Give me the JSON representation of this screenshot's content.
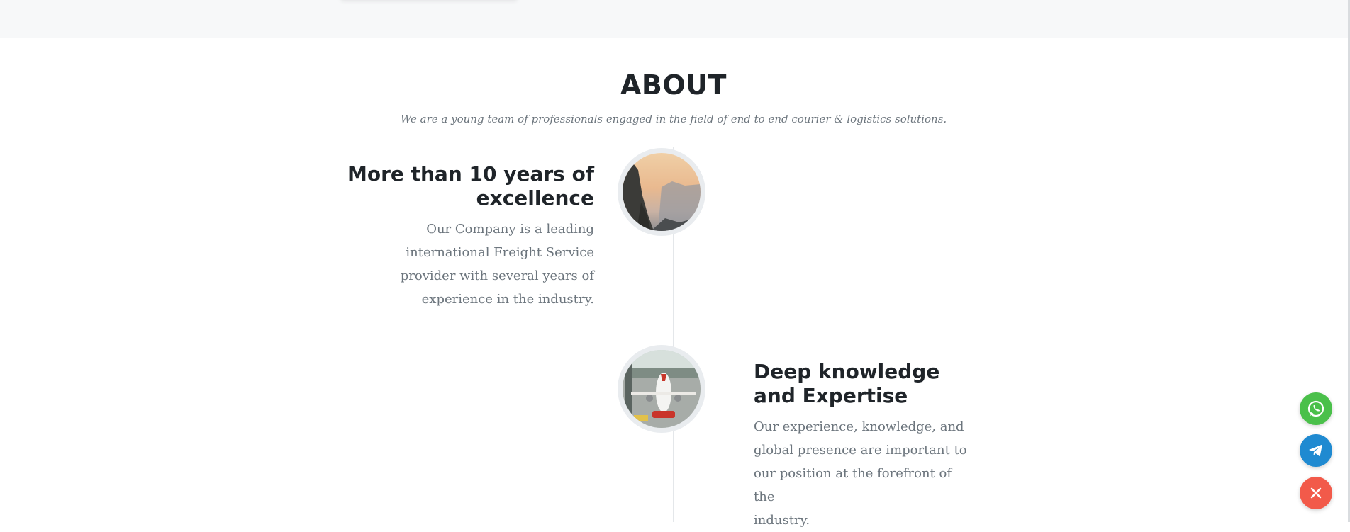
{
  "about": {
    "title": "ABOUT",
    "subtitle": "We are a young team of professionals engaged in the field of end to end courier & logistics solutions."
  },
  "timeline": [
    {
      "heading_line1": "More than 10 years of",
      "heading_line2": "excellence",
      "text_line1": "Our Company is a leading",
      "text_line2": "international Freight Service",
      "text_line3": "provider with several years of",
      "text_line4": "experience in the industry.",
      "image": "mountain-valley-photo"
    },
    {
      "heading_line1": "Deep knowledge",
      "heading_line2": "and Expertise",
      "text_line1": "Our experience, knowledge, and",
      "text_line2": "global presence are important to",
      "text_line3": "our position at the forefront of the",
      "text_line4": "industry.",
      "image": "airplane-on-tarmac-photo"
    }
  ],
  "floating_buttons": [
    {
      "icon": "whatsapp-icon",
      "color": "#4ac04a"
    },
    {
      "icon": "telegram-icon",
      "color": "#1f8ad1"
    },
    {
      "icon": "close-icon",
      "color": "#f25a4a"
    }
  ],
  "colors": {
    "heading": "#1f2429",
    "body_text": "#6c757d",
    "top_band": "#f7f8f9",
    "timeline_line": "#e4e7ea"
  }
}
